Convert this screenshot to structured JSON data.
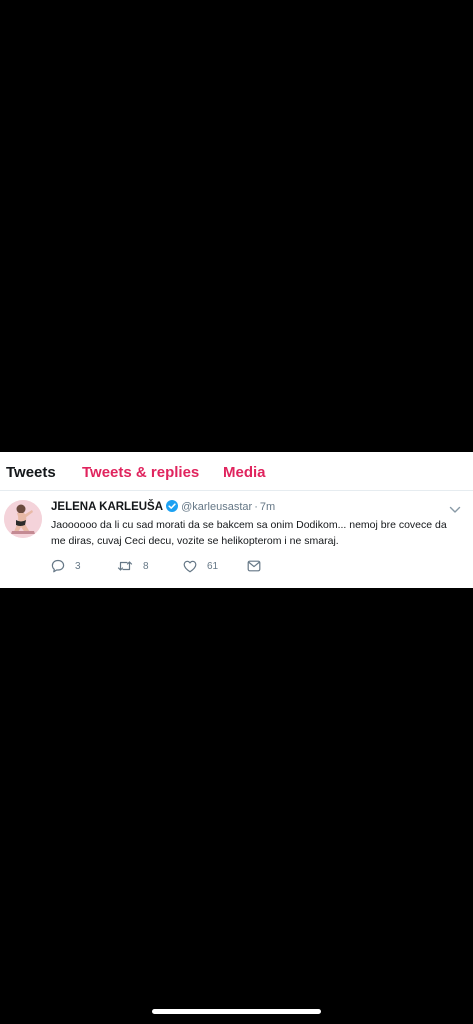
{
  "tabs": {
    "tweets": "Tweets",
    "tweets_replies": "Tweets & replies",
    "media": "Media"
  },
  "tweet": {
    "display_name": "JELENA KARLEUŠA",
    "handle": "@karleusastar",
    "separator": "·",
    "time": "7m",
    "text": "Jaoooooo da li cu sad morati da se bakcem sa onim Dodikom... nemoj bre covece da me diras, cuvaj Ceci decu, vozite se helikopterom i ne smaraj.",
    "replies": "3",
    "retweets": "8",
    "likes": "61"
  },
  "colors": {
    "accent": "#e0245e",
    "verified": "#1da1f2",
    "muted": "#657786",
    "text": "#14171a",
    "background": "#000000"
  },
  "icons": {
    "verified": "verified-badge-icon",
    "menu": "chevron-down-icon",
    "reply": "reply-icon",
    "retweet": "retweet-icon",
    "like": "heart-icon",
    "message": "envelope-icon"
  }
}
